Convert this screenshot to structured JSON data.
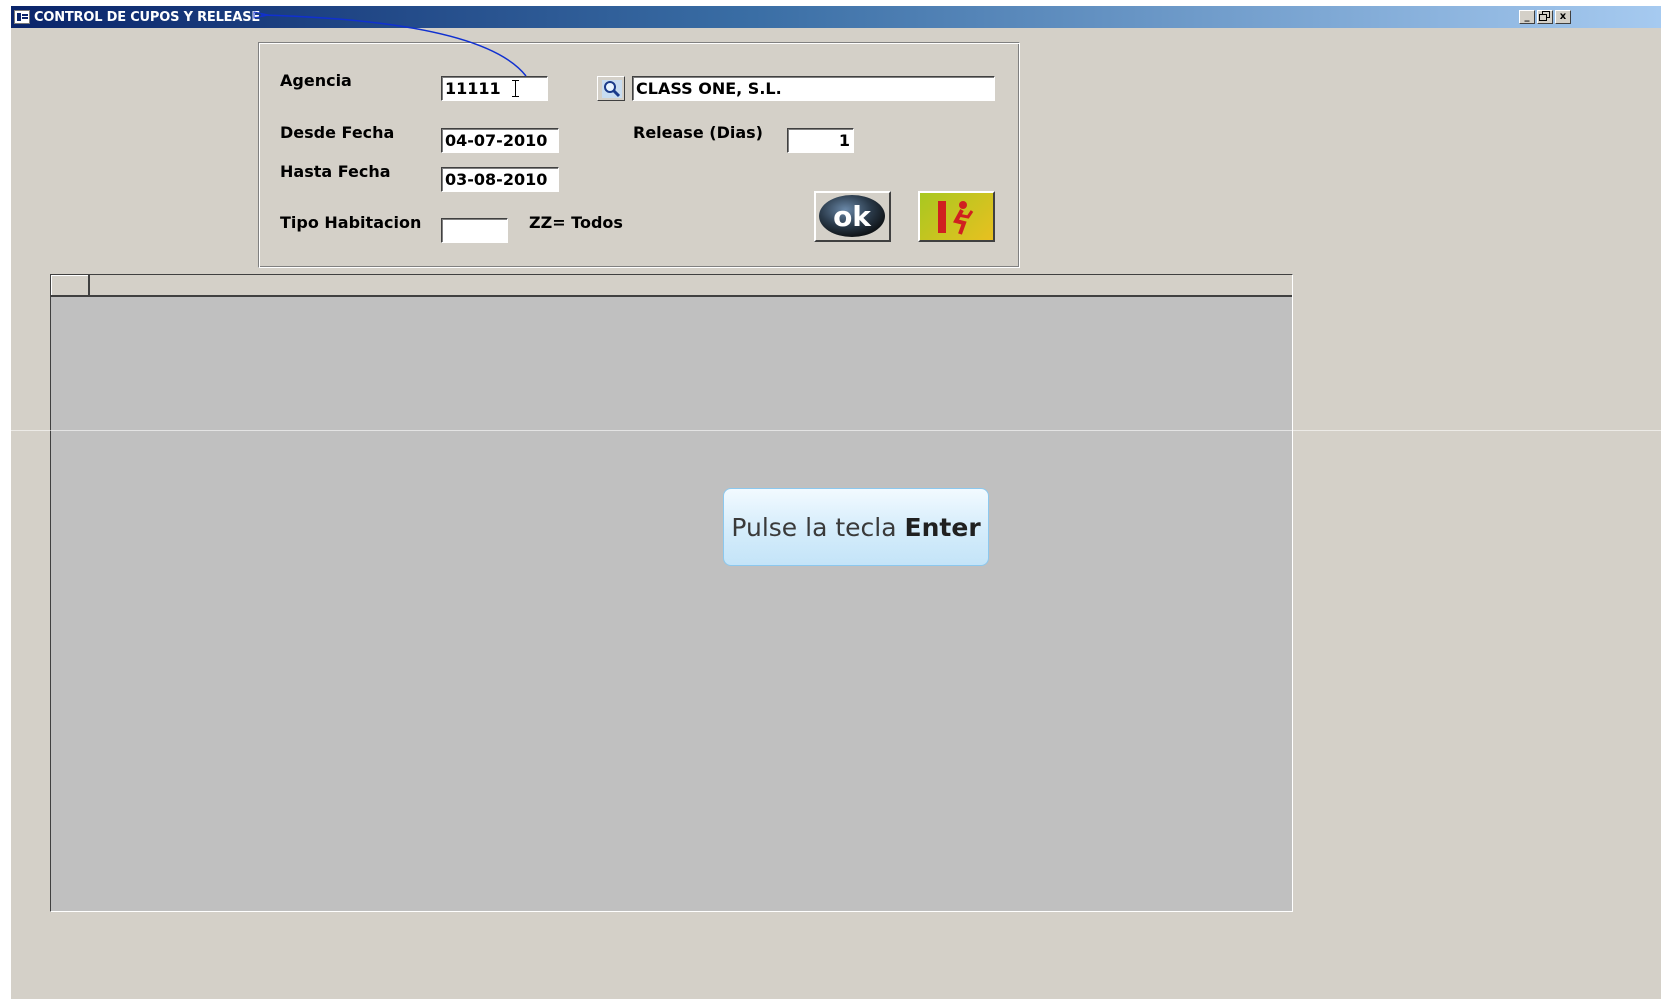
{
  "window": {
    "title": "CONTROL DE CUPOS Y RELEASE",
    "controls": {
      "minimize": "_",
      "restore": "🗗",
      "close": "x"
    }
  },
  "form": {
    "agencia": {
      "label": "Agencia",
      "code": "11111",
      "name": "CLASS ONE, S.L."
    },
    "desde_fecha": {
      "label": "Desde Fecha",
      "value": "04-07-2010"
    },
    "hasta_fecha": {
      "label": "Hasta Fecha",
      "value": "03-08-2010"
    },
    "release": {
      "label": "Release (Dias)",
      "value": "1"
    },
    "tipo_habitacion": {
      "label": "Tipo Habitacion",
      "value": "",
      "hint": "ZZ= Todos"
    },
    "buttons": {
      "search_icon": "magnifier-icon",
      "ok_label": "ok",
      "exit_icon": "exit-door-icon"
    }
  },
  "grid": {
    "columns": [],
    "rows": []
  },
  "overlay_hint": {
    "prefix": "Pulse la tecla",
    "key": "Enter"
  },
  "colors": {
    "window_bg": "#d4d0c8",
    "grid_bg": "#c0c0c0",
    "titlebar_start": "#0a246a",
    "titlebar_end": "#a6caf0",
    "hint_border": "#8cc8ee"
  }
}
